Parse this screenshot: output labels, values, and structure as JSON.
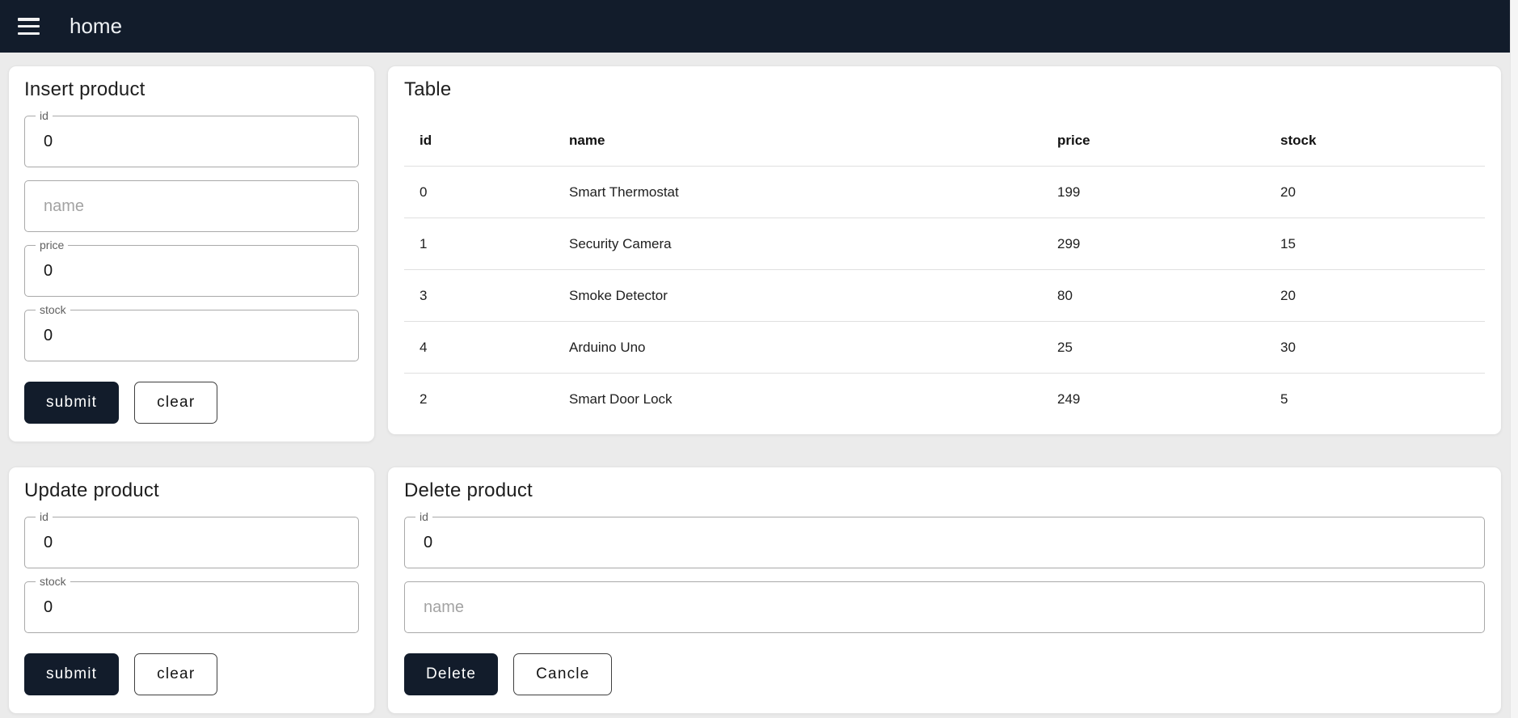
{
  "topbar": {
    "title": "home",
    "menu_icon": "hamburger-menu-icon"
  },
  "insert_panel": {
    "title": "Insert product",
    "id_label": "id",
    "id_value": "0",
    "name_placeholder": "name",
    "price_label": "price",
    "price_value": "0",
    "stock_label": "stock",
    "stock_value": "0",
    "submit_label": "submit",
    "clear_label": "clear"
  },
  "table_panel": {
    "title": "Table",
    "columns": [
      "id",
      "name",
      "price",
      "stock"
    ],
    "rows": [
      [
        "0",
        "Smart Thermostat",
        "199",
        "20"
      ],
      [
        "1",
        "Security Camera",
        "299",
        "15"
      ],
      [
        "3",
        "Smoke Detector",
        "80",
        "20"
      ],
      [
        "4",
        "Arduino Uno",
        "25",
        "30"
      ],
      [
        "2",
        "Smart Door Lock",
        "249",
        "5"
      ]
    ]
  },
  "update_panel": {
    "title": "Update product",
    "id_label": "id",
    "id_value": "0",
    "stock_label": "stock",
    "stock_value": "0",
    "submit_label": "submit",
    "clear_label": "clear"
  },
  "delete_panel": {
    "title": "Delete product",
    "id_label": "id",
    "id_value": "0",
    "name_placeholder": "name",
    "delete_label": "Delete",
    "cancel_label": "Cancle"
  },
  "colors": {
    "topbar_bg": "#121c2b",
    "page_bg": "#ebebeb",
    "accent": "#121c2b",
    "divider": "#e0e0e0"
  }
}
